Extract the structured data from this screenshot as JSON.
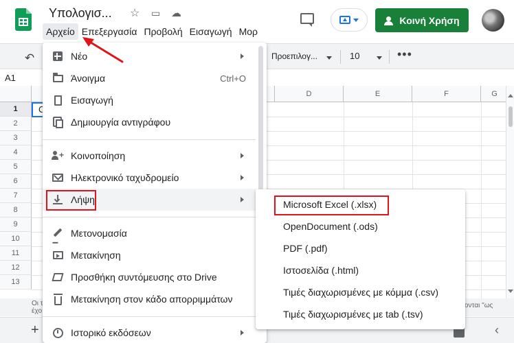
{
  "app": {
    "doc_title": "Υπολογισ...",
    "title_icons": [
      "star-icon",
      "move-to-folder-icon",
      "cloud-status-icon"
    ]
  },
  "menubar": {
    "items": [
      "Αρχείο",
      "Επεξεργασία",
      "Προβολή",
      "Εισαγωγή",
      "Μορ"
    ],
    "active": "Αρχείο"
  },
  "header": {
    "share_label": "Κοινή Χρήση",
    "share_color": "#188038",
    "accent_color": "#1a73e8"
  },
  "toolbar": {
    "font": "Προεπιλογ...",
    "font_size": "10",
    "more": "•••"
  },
  "formula_bar": {
    "cell_ref": "A1"
  },
  "grid": {
    "columns": [
      "D",
      "E",
      "F",
      "G"
    ],
    "rows": [
      "1",
      "2",
      "3",
      "4",
      "5",
      "6",
      "7",
      "8",
      "9",
      "10",
      "11",
      "12",
      "13"
    ],
    "cell_a1_text": "C"
  },
  "footnote": {
    "left_line1": "Οι τ",
    "left_line2": "έχο",
    "right_line1": "ονται \"ως"
  },
  "sheetbar": {
    "add_sheet": "+"
  },
  "file_menu": {
    "items": [
      {
        "label": "Νέο",
        "icon": "new-icon",
        "submenu": true
      },
      {
        "label": "Άνοιγμα",
        "icon": "folder-icon",
        "shortcut": "Ctrl+O"
      },
      {
        "label": "Εισαγωγή",
        "icon": "document-icon"
      },
      {
        "label": "Δημιουργία αντιγράφου",
        "icon": "copy-icon"
      },
      {
        "label": "Κοινοποίηση",
        "icon": "share-person-icon",
        "submenu": true
      },
      {
        "label": "Ηλεκτρονικό ταχυδρομείο",
        "icon": "email-icon",
        "submenu": true
      },
      {
        "label": "Λήψη",
        "icon": "download-icon",
        "submenu": true,
        "highlighted": true
      },
      {
        "label": "Μετονομασία",
        "icon": "rename-icon"
      },
      {
        "label": "Μετακίνηση",
        "icon": "move-icon"
      },
      {
        "label": "Προσθήκη συντόμευσης στο Drive",
        "icon": "drive-shortcut-icon"
      },
      {
        "label": "Μετακίνηση στον κάδο απορριμμάτων",
        "icon": "trash-icon"
      },
      {
        "label": "Ιστορικό εκδόσεων",
        "icon": "history-icon",
        "submenu": true
      }
    ]
  },
  "download_submenu": {
    "items": [
      "Microsoft Excel (.xlsx)",
      "OpenDocument (.ods)",
      "PDF (.pdf)",
      "Ιστοσελίδα (.html)",
      "Τιμές διαχωρισμένες με κόμμα (.csv)",
      "Τιμές διαχωρισμένες με tab (.tsv)"
    ]
  },
  "annotation_color": "#e0131a"
}
